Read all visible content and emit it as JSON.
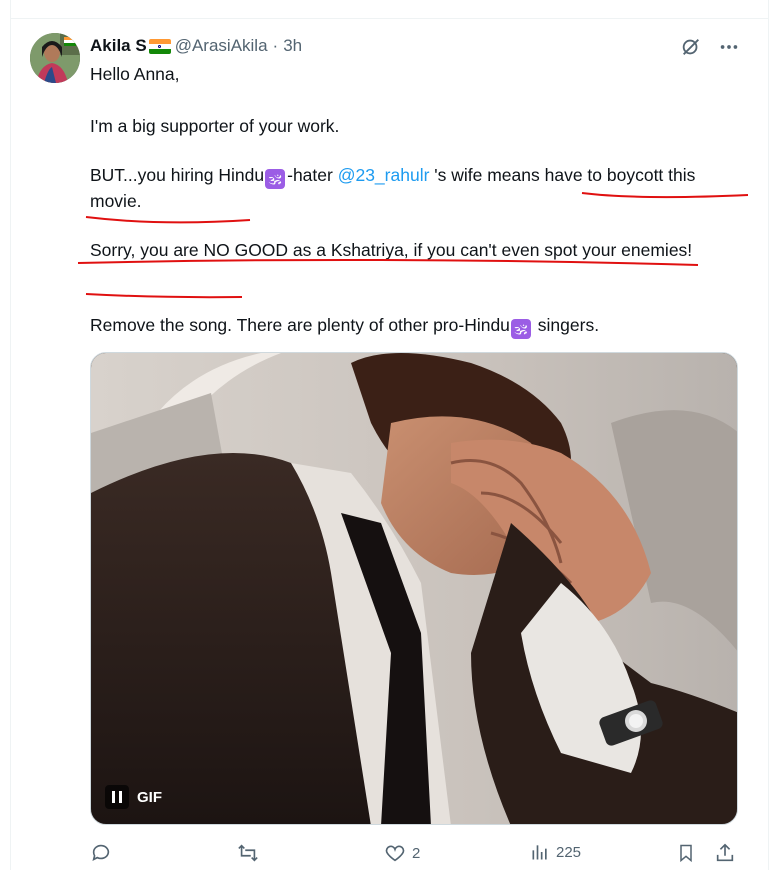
{
  "tweet": {
    "author": {
      "name": "Akila S",
      "handle": "@ArasiAkila",
      "separator": "·",
      "time": "3h",
      "flag_icon": "india-flag-icon"
    },
    "paragraphs": {
      "p1": "Hello Anna,",
      "p2": "I'm a big supporter of your work.",
      "p3a": "BUT...you hiring Hindu",
      "p3b": "-hater ",
      "p3_mention": "@23_rahulr",
      "p3c": " 's wife means have to boycott this movie.",
      "p4": "Sorry, you are NO GOOD as a Kshatriya, if you can't even spot your enemies!",
      "p5a": "Remove the song. There are plenty of other pro-Hindu",
      "p5b": " singers."
    },
    "om_glyph": "🕉",
    "media": {
      "type": "GIF",
      "badge": "GIF",
      "playing": true
    },
    "actions": {
      "reply_count": "",
      "retweet_count": "",
      "like_count": "2",
      "views_count": "225"
    }
  },
  "colors": {
    "text": "#0f1419",
    "muted": "#536471",
    "link": "#1d9bf0",
    "annotation": "#e01010",
    "om_badge": "#9b5de5"
  }
}
